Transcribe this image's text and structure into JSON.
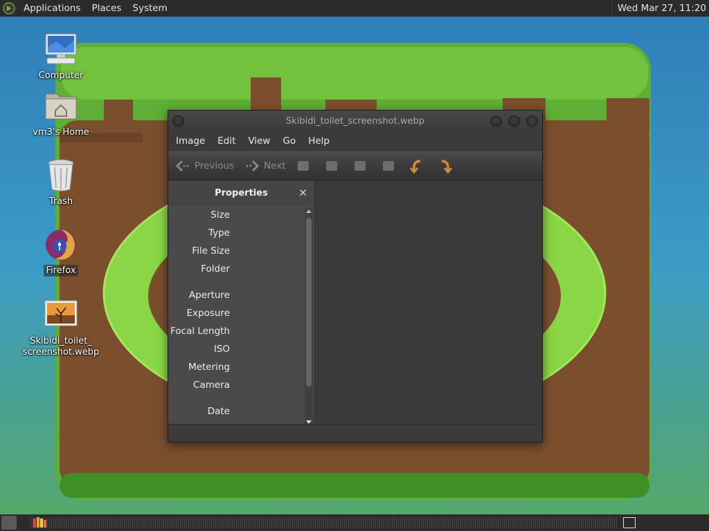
{
  "colors": {
    "panel": "#2b2b2b",
    "window_bg": "#3b3b3b",
    "sidepane_bg": "#4a4a4a",
    "sky": "#3a93c8",
    "grass": "#6dbb3b",
    "dirt": "#7b4f2e",
    "ring": "#8ad64a"
  },
  "top_panel": {
    "menus": [
      "Applications",
      "Places",
      "System"
    ],
    "clock": "Wed Mar 27, 11:20"
  },
  "desktop": {
    "icons": [
      {
        "label": "Computer",
        "icon": "computer-icon"
      },
      {
        "label": "vm3's Home",
        "icon": "home-folder-icon"
      },
      {
        "label": "Trash",
        "icon": "trash-icon"
      },
      {
        "label": "Firefox",
        "icon": "firefox-icon"
      },
      {
        "label": "Skibidi_toilet_\nscreenshot.webp",
        "label_line1": "Skibidi_toilet_",
        "label_line2": "screenshot.webp",
        "icon": "image-file-icon"
      }
    ]
  },
  "window": {
    "title": "Skibidi_toilet_screenshot.webp",
    "menus": [
      "Image",
      "Edit",
      "View",
      "Go",
      "Help"
    ],
    "toolbar": {
      "previous_label": "Previous",
      "next_label": "Next",
      "icons": [
        "zoom-in-icon",
        "zoom-out-icon",
        "normal-size-icon",
        "best-fit-icon",
        "rotate-left-icon",
        "rotate-right-icon"
      ]
    },
    "sidebar": {
      "title": "Properties",
      "properties": [
        "Size",
        "Type",
        "File Size",
        "Folder",
        "Aperture",
        "Exposure",
        "Focal Length",
        "ISO",
        "Metering",
        "Camera",
        "Date"
      ]
    }
  }
}
